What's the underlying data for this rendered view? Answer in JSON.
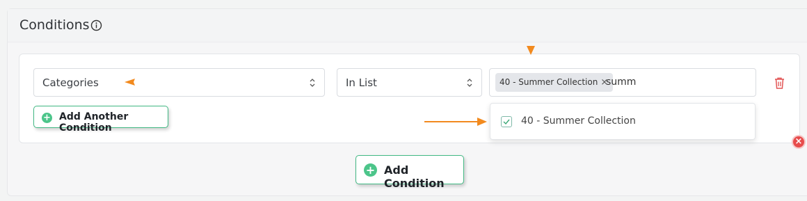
{
  "section": {
    "title": "Conditions",
    "info_icon": "info-icon"
  },
  "condition_row": {
    "field_value": "Categories",
    "operator_value": "In List",
    "selected_tags": [
      {
        "label": "40 - Summer Collection",
        "remove_glyph": "×"
      }
    ],
    "search_text": "summ",
    "delete_icon": "trash-icon"
  },
  "dropdown": {
    "options": [
      {
        "label": "40 - Summer Collection",
        "checked": true
      }
    ]
  },
  "buttons": {
    "add_another_condition": "Add Another Condition",
    "add_condition": "Add Condition",
    "plus_glyph": "+"
  },
  "overlay": {
    "close_glyph": "×"
  },
  "colors": {
    "accent_green": "#41b883",
    "annotation_orange": "#f28a1e",
    "danger_red": "#e74c4c"
  }
}
